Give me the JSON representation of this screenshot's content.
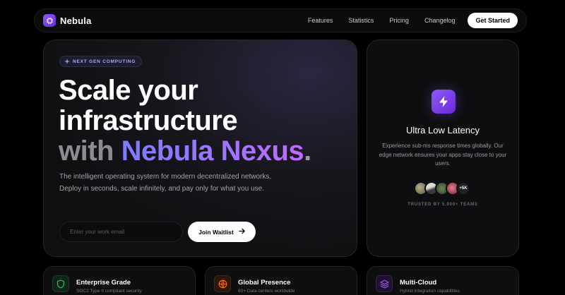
{
  "nav": {
    "brand": "Nebula",
    "links": [
      "Features",
      "Statistics",
      "Pricing",
      "Changelog"
    ],
    "cta": "Get Started"
  },
  "hero": {
    "badge": "NEXT GEN COMPUTING",
    "headline_line1": "Scale your",
    "headline_line2": "infrastructure",
    "headline_line3_prefix": "with",
    "headline_line3_highlight": "Nebula Nexus",
    "headline_line3_suffix": ".",
    "subtitle": "The intelligent operating system for modern decentralized networks. Deploy in seconds, scale infinitely, and pay only for what you use.",
    "email_placeholder": "Enter your work email",
    "join_label": "Join Waitlist"
  },
  "side": {
    "title": "Ultra Low Latency",
    "description": "Experience sub-ms response times globally. Our edge network ensures your apps stay close to your users.",
    "avatar_more": "+5K",
    "trusted": "TRUSTED BY 5,000+ TEAMS"
  },
  "features": [
    {
      "title": "Enterprise Grade",
      "subtitle": "SOC2 Type II compliant security",
      "icon": "shield-icon",
      "color": "#22c55e"
    },
    {
      "title": "Global Presence",
      "subtitle": "60+ Data centers worldwide",
      "icon": "globe-icon",
      "color": "#f97316"
    },
    {
      "title": "Multi-Cloud",
      "subtitle": "Hybrid integration capabilities",
      "icon": "layers-icon",
      "color": "#a855f7"
    }
  ],
  "colors": {
    "accent": "#8b5cf6",
    "gradient_start": "#7c7dff",
    "gradient_end": "#c069ff"
  }
}
